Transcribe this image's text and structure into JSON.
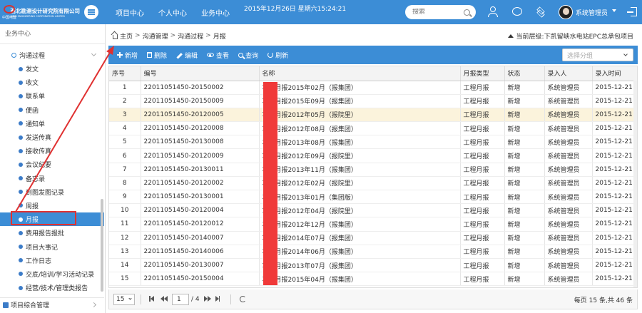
{
  "header": {
    "org_name": "西北勘测设计研究院有限公司",
    "org_en": "XIBEI ENGINEERING CORPORATION LIMITED",
    "logo_sub": "中国电建",
    "nav": [
      "项目中心",
      "个人中心",
      "业务中心"
    ],
    "datetime": "2015年12月26日 星期六15:24:21",
    "search_placeholder": "搜索",
    "user_name": "系统管理员"
  },
  "sidebar": {
    "title": "业务中心",
    "group": "沟通过程",
    "items": [
      "发文",
      "收文",
      "联系单",
      "便函",
      "通知单",
      "发送传真",
      "接收传真",
      "会议纪要",
      "备忘录",
      "到图发图记录",
      "周报",
      "月报",
      "费用报告报批",
      "项目大事记",
      "工作日志",
      "交底/培训/学习活动记录",
      "经营/技术/管理类报告"
    ],
    "active_index": 11,
    "footer": "项目综合管理"
  },
  "breadcrumb": [
    "主页",
    "沟通管理",
    "沟通过程",
    "月报"
  ],
  "project": {
    "label": "当前层级:",
    "value": "下凯留峡水电站EPC总承包项目"
  },
  "toolbar": {
    "add": "新增",
    "delete": "删除",
    "edit": "编辑",
    "view": "查看",
    "query": "查询",
    "refresh": "刷新",
    "group_placeholder": "选择分组"
  },
  "table": {
    "columns": [
      "序号",
      "编号",
      "名称",
      "月报类型",
      "状态",
      "录入人",
      "录入时间"
    ],
    "selected_row": 2,
    "rows": [
      [
        "1",
        "22011051450-20150002",
        "项目月报2015年02月（报集团）",
        "工程月报",
        "新增",
        "系统管理员",
        "2015-12-21"
      ],
      [
        "2",
        "22011051450-20150009",
        "项目月报2015年09月（报集团）",
        "工程月报",
        "新增",
        "系统管理员",
        "2015-12-21"
      ],
      [
        "3",
        "22011051450-20120005",
        "项目月报2012年05月（报院里）",
        "工程月报",
        "新增",
        "系统管理员",
        "2015-12-21"
      ],
      [
        "4",
        "22011051450-20120008",
        "项目月报2012年08月（报集团）",
        "工程月报",
        "新增",
        "系统管理员",
        "2015-12-21"
      ],
      [
        "5",
        "22011051450-20130008",
        "项目月报2013年08月（报集团）",
        "工程月报",
        "新增",
        "系统管理员",
        "2015-12-21"
      ],
      [
        "6",
        "22011051450-20120009",
        "项目月报2012年09月（报院里）",
        "工程月报",
        "新增",
        "系统管理员",
        "2015-12-21"
      ],
      [
        "7",
        "22011051450-20130011",
        "项目月报2013年11月（报集团）",
        "工程月报",
        "新增",
        "系统管理员",
        "2015-12-21"
      ],
      [
        "8",
        "22011051450-20120002",
        "项目月报2012年02月（报院里）",
        "工程月报",
        "新增",
        "系统管理员",
        "2015-12-21"
      ],
      [
        "9",
        "22011051450-20130001",
        "项目月报2013年01月（集团版）",
        "工程月报",
        "新增",
        "系统管理员",
        "2015-12-21"
      ],
      [
        "10",
        "22011051450-20120004",
        "项目月报2012年04月（报院里）",
        "工程月报",
        "新增",
        "系统管理员",
        "2015-12-21"
      ],
      [
        "11",
        "22011051450-20120012",
        "项目月报2012年12月（报集团）",
        "工程月报",
        "新增",
        "系统管理员",
        "2015-12-21"
      ],
      [
        "12",
        "22011051450-20140007",
        "项目月报2014年07月（报集团）",
        "工程月报",
        "新增",
        "系统管理员",
        "2015-12-21"
      ],
      [
        "13",
        "22011051450-20140006",
        "项目月报2014年06月（报集团）",
        "工程月报",
        "新增",
        "系统管理员",
        "2015-12-21"
      ],
      [
        "14",
        "22011051450-20130007",
        "项目月报2013年07月（报集团）",
        "工程月报",
        "新增",
        "系统管理员",
        "2015-12-21"
      ],
      [
        "15",
        "22011051450-20150004",
        "项目月报2015年04月（报集团）",
        "工程月报",
        "新增",
        "系统管理员",
        "2015-12-21"
      ]
    ]
  },
  "pager": {
    "page_size": "15",
    "current_page": "1",
    "total_pages": "/ 4",
    "info": "每页 15 条,共 46 条"
  },
  "colors": {
    "primary": "#3c8dd6",
    "selected_row": "#fbf3dc",
    "annotation": "#e03131"
  }
}
